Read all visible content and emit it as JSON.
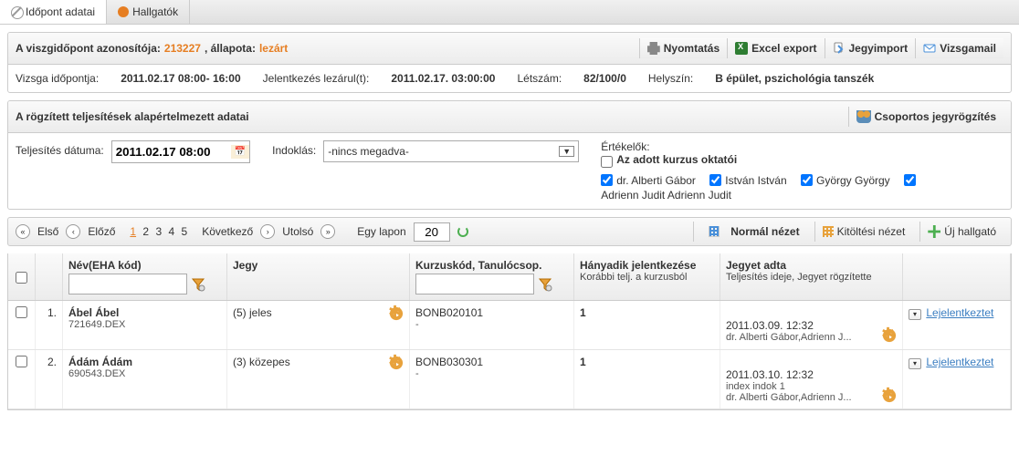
{
  "tabs": {
    "schedule": "Időpont adatai",
    "students": "Hallgatók"
  },
  "summary": {
    "id_label": "A viszgidőpont azonosítója:",
    "id_value": "213227",
    "status_sep": ", állapota:",
    "status_value": "lezárt",
    "btns": {
      "print": "Nyomtatás",
      "excel": "Excel export",
      "import": "Jegyimport",
      "mail": "Vizsgamail"
    },
    "exam_time_label": "Vizsga időpontja:",
    "exam_time_value": "2011.02.17 08:00- 16:00",
    "reg_close_label": "Jelentkezés lezárul(t):",
    "reg_close_value": "2011.02.17. 03:00:00",
    "headcount_label": "Létszám:",
    "headcount_value": "82/100/0",
    "location_label": "Helyszín:",
    "location_value": "B épület, pszichológia tanszék"
  },
  "defaults": {
    "title": "A rögzített teljesítések alapértelmezett adatai",
    "group_btn": "Csoportos jegyrögzítés",
    "date_label": "Teljesítés dátuma:",
    "date_value": "2011.02.17 08:00",
    "reason_label": "Indoklás:",
    "reason_value": "-nincs megadva-",
    "eval_label": "Értékelők:",
    "eval_course": "Az adott kurzus oktatói",
    "eval1": "dr. Alberti Gábor",
    "eval2": "István István",
    "eval3": "György György",
    "eval_extra": "Adrienn Judit Adrienn Judit"
  },
  "pager": {
    "first": "Első",
    "prev": "Előző",
    "pages": [
      "1",
      "2",
      "3",
      "4",
      "5"
    ],
    "next": "Következő",
    "last": "Utolsó",
    "perpage_label": "Egy lapon",
    "perpage_value": "20",
    "normal_view": "Normál nézet",
    "fill_view": "Kitöltési nézet",
    "new_student": "Új hallgató"
  },
  "grid": {
    "col_name": "Név(EHA kód)",
    "col_grade": "Jegy",
    "col_course": "Kurzuskód, Tanulócsop.",
    "col_attempt": "Hányadik jelentkezése",
    "col_attempt_sub": "Korábbi telj. a kurzusból",
    "col_given": "Jegyet adta",
    "col_given_sub": "Teljesítés ideje, Jegyet rögzítette",
    "rows": [
      {
        "num": "1.",
        "name": "Ábel Ábel",
        "eha": "721649.DEX",
        "grade": "(5) jeles",
        "course": "BONB020101",
        "group": "-",
        "attempt": "1",
        "given_time": "2011.03.09. 12:32",
        "given_by": "dr. Alberti Gábor,Adrienn J...",
        "reason": "",
        "action": "Lejelentkeztet"
      },
      {
        "num": "2.",
        "name": "Ádám Ádám",
        "eha": "690543.DEX",
        "grade": "(3) közepes",
        "course": "BONB030301",
        "group": "-",
        "attempt": "1",
        "given_time": "2011.03.10. 12:32",
        "given_by": "dr. Alberti Gábor,Adrienn J...",
        "reason": "index indok 1",
        "action": "Lejelentkeztet"
      }
    ]
  }
}
